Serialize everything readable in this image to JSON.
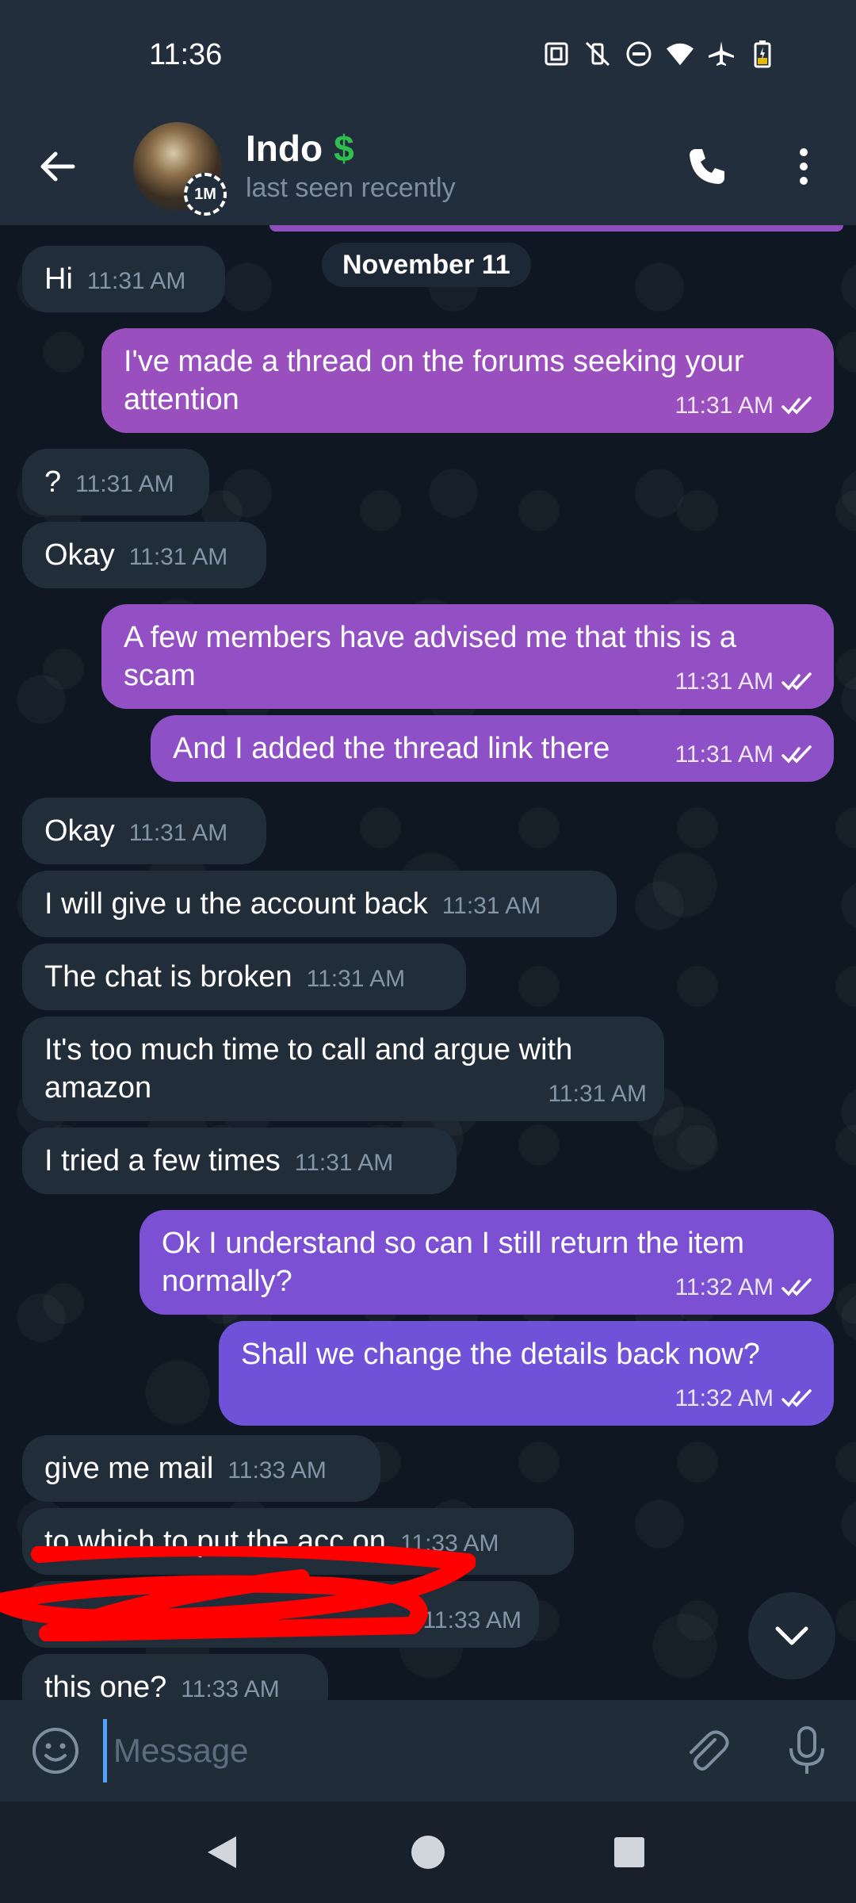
{
  "status_bar": {
    "time": "11:36",
    "icons": [
      "nfc-icon",
      "vibrate-off-icon",
      "dnd-icon",
      "wifi-icon",
      "airplane-icon",
      "battery-charging-icon"
    ]
  },
  "header": {
    "name": "Indo",
    "name_badge": "$",
    "status": "last seen recently",
    "avatar_badge": "1M"
  },
  "chat": {
    "date_label": "November 11",
    "messages": [
      {
        "dir": "in",
        "text": "Hi",
        "time": "11:31 AM"
      },
      {
        "dir": "out",
        "text": "I've made a thread on the forums seeking your attention",
        "time": "11:31 AM"
      },
      {
        "dir": "in",
        "text": "?",
        "time": "11:31 AM"
      },
      {
        "dir": "in",
        "text": "Okay",
        "time": "11:31 AM"
      },
      {
        "dir": "out",
        "text": "A few members have advised me that this is a scam",
        "time": "11:31 AM"
      },
      {
        "dir": "out",
        "text": "And I added the thread link there",
        "time": "11:31 AM"
      },
      {
        "dir": "in",
        "text": "Okay",
        "time": "11:31 AM"
      },
      {
        "dir": "in",
        "text": "I will give u the account back",
        "time": "11:31 AM"
      },
      {
        "dir": "in",
        "text": "The chat is broken",
        "time": "11:31 AM"
      },
      {
        "dir": "in",
        "text": "It's too much time to call and argue with amazon",
        "time": "11:31 AM"
      },
      {
        "dir": "in",
        "text": "I tried a few times",
        "time": "11:31 AM"
      },
      {
        "dir": "out",
        "text": "Ok I understand so can I still return the item normally?",
        "time": "11:32 AM"
      },
      {
        "dir": "out",
        "text": "Shall we change the details back now?",
        "time": "11:32 AM"
      },
      {
        "dir": "in",
        "text": "give me mail",
        "time": "11:33 AM"
      },
      {
        "dir": "in",
        "text": "to which to put the acc on",
        "time": "11:33 AM"
      },
      {
        "dir": "in",
        "text": "",
        "time": "11:33 AM"
      },
      {
        "dir": "in",
        "text": "this one?",
        "time": "11:33 AM"
      }
    ]
  },
  "input": {
    "placeholder": "Message"
  },
  "colors": {
    "outgoing_pink": "#9a4fbf",
    "outgoing_purple": "#7e4fd0",
    "outgoing_indigo": "#6e4fd8",
    "incoming": "#222d3a",
    "redaction": "#ff0000"
  }
}
